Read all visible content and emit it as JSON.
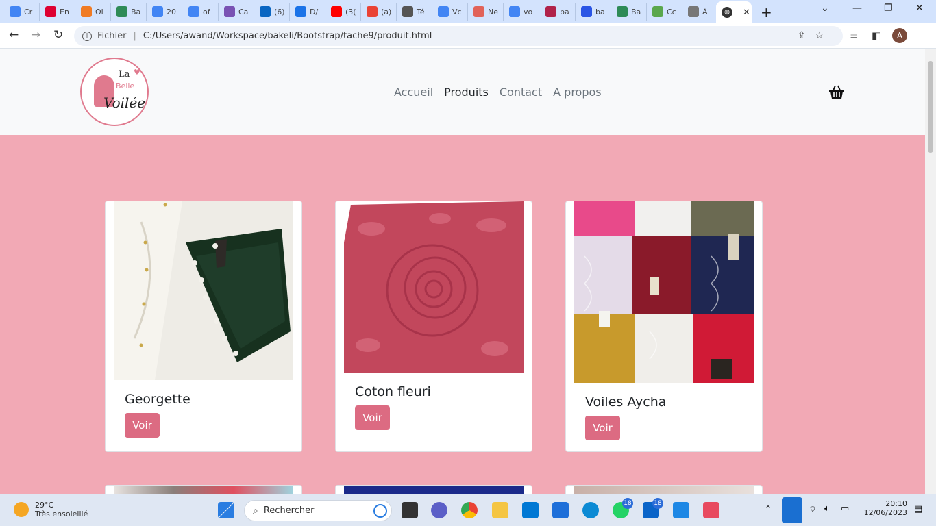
{
  "browser": {
    "tabs": [
      {
        "label": "Cr",
        "icon": "google-icon",
        "color": "#4285f4"
      },
      {
        "label": "En",
        "icon": "angular-icon",
        "color": "#dd0031"
      },
      {
        "label": "Ol",
        "icon": "ol-icon",
        "color": "#f07b24"
      },
      {
        "label": "Ba",
        "icon": "bakeli-icon",
        "color": "#2e8b57"
      },
      {
        "label": "20",
        "icon": "docs-icon",
        "color": "#4285f4"
      },
      {
        "label": "of",
        "icon": "google-icon",
        "color": "#4285f4"
      },
      {
        "label": "Ca",
        "icon": "bootstrap-icon",
        "color": "#7952b3"
      },
      {
        "label": "(6)",
        "icon": "linkedin-icon",
        "color": "#0a66c2"
      },
      {
        "label": "D/",
        "icon": "drive-icon",
        "color": "#1a73e8"
      },
      {
        "label": "(3(",
        "icon": "youtube-icon",
        "color": "#ff0000"
      },
      {
        "label": "(a)",
        "icon": "gmail-icon",
        "color": "#ea4335"
      },
      {
        "label": "Té",
        "icon": "download-icon",
        "color": "#555555"
      },
      {
        "label": "Vc",
        "icon": "google-icon",
        "color": "#4285f4"
      },
      {
        "label": "Ne",
        "icon": "notion-icon",
        "color": "#e16259"
      },
      {
        "label": "vo",
        "icon": "google-icon",
        "color": "#4285f4"
      },
      {
        "label": "ba",
        "icon": "tag-icon",
        "color": "#b0224a"
      },
      {
        "label": "ba",
        "icon": "wix-icon",
        "color": "#2a55e5"
      },
      {
        "label": "Ba",
        "icon": "bakeli-icon",
        "color": "#2e8b57"
      },
      {
        "label": "Cc",
        "icon": "shopify-icon",
        "color": "#5aa74c"
      },
      {
        "label": "À",
        "icon": "castle-icon",
        "color": "#777777"
      }
    ],
    "active_tab": {
      "icon": "globe-icon"
    },
    "url_prefix": "Fichier",
    "url": "C:/Users/awand/Workspace/bakeli/Bootstrap/tache9/produit.html",
    "profile_initial": "A"
  },
  "site": {
    "logo": {
      "la": "La",
      "belle": "Belle",
      "voilee": "Voilée",
      "heart": "♥"
    },
    "nav": [
      "Accueil",
      "Produits",
      "Contact",
      "A propos"
    ],
    "active_nav": "Produits",
    "accent_color": "#dc6b82",
    "background_color": "#f2a9b5",
    "products": [
      {
        "title": "Georgette",
        "button": "Voir",
        "image": "dark-green-hijab-with-pearls"
      },
      {
        "title": "Coton fleuri",
        "button": "Voir",
        "image": "pink-floral-cotton-scarf"
      },
      {
        "title": "Voiles Aycha",
        "button": "Voir",
        "image": "grid-of-embroidered-veils"
      }
    ]
  },
  "taskbar": {
    "weather_temp": "29°C",
    "weather_desc": "Très ensoleillé",
    "search_placeholder": "Rechercher",
    "time": "20:10",
    "date": "12/06/2023",
    "whatsapp_badge": "18",
    "mail_badge": "18"
  }
}
